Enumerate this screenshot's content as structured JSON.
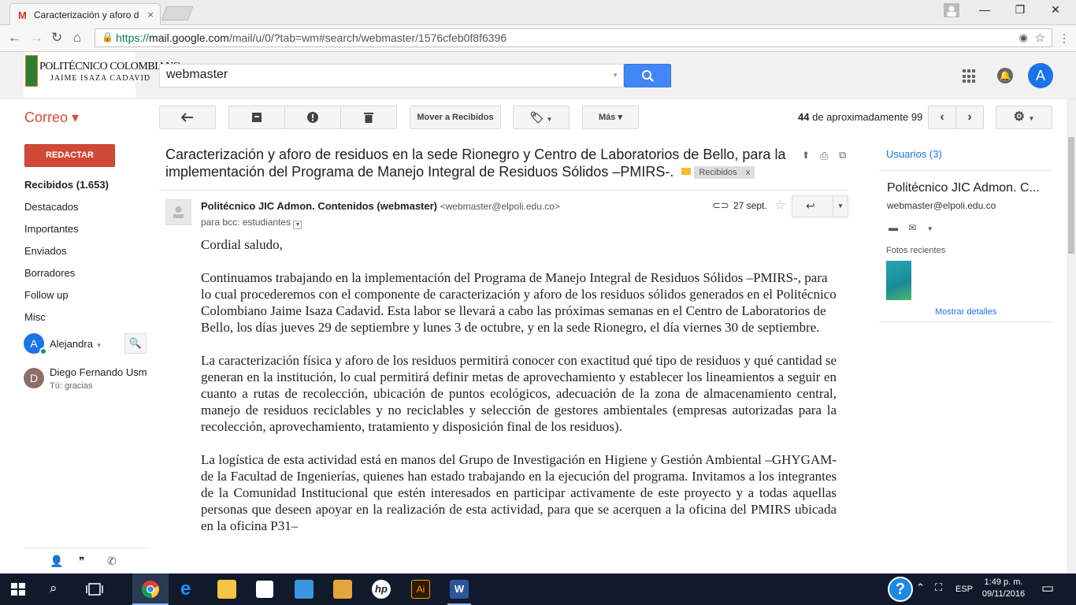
{
  "browser": {
    "tab_title": "Caracterización y aforo d",
    "url_https": "https://",
    "url_host": "mail.google.com",
    "url_path": "/mail/u/0/?tab=wm#search/webmaster/1576cfeb0f8f6396"
  },
  "header": {
    "logo_line1": "POLITÉCNICO COLOMBIANO",
    "logo_line2": "JAIME ISAZA CADAVID",
    "search_value": "webmaster",
    "account_initial": "A"
  },
  "toolbar": {
    "correo_label": "Correo ▾",
    "move_inbox_label": "Mover a Recibidos",
    "more_label": "Más ▾",
    "count_bold": "44",
    "count_text": "de aproximadamente 99"
  },
  "sidebar": {
    "compose_label": "REDACTAR",
    "items": [
      {
        "label": "Recibidos (1.653)"
      },
      {
        "label": "Destacados"
      },
      {
        "label": "Importantes"
      },
      {
        "label": "Enviados"
      },
      {
        "label": "Borradores"
      },
      {
        "label": "Follow up"
      },
      {
        "label": "Misc"
      }
    ],
    "me_initial": "A",
    "me_name": "Alejandra",
    "contact_initial": "D",
    "contact_name": "Diego Fernando Usm",
    "contact_sub": "Tú: gracias"
  },
  "message": {
    "subject": "Caracterización y aforo de residuos en la sede Rionegro y Centro de Laboratorios de Bello, para la implementación del Programa de Manejo Integral de Residuos Sólidos –PMIRS-.",
    "label_chip": "Recibidos",
    "sender_name": "Politécnico JIC Admon. Contenidos (webmaster)",
    "sender_email": "<webmaster@elpoli.edu.co>",
    "to": "para bcc: estudiantes",
    "date": "27 sept.",
    "greeting": "Cordial saludo,",
    "p1": "Continuamos trabajando en la implementación del Programa de Manejo Integral de Residuos Sólidos –PMIRS-, para lo cual procederemos con el componente de caracterización y aforo de los residuos sólidos generados en el Politécnico Colombiano Jaime Isaza Cadavid. Esta labor se llevará a cabo las próximas semanas en el Centro de Laboratorios de Bello, los días jueves 29 de septiembre y lunes 3 de octubre, y en la sede Rionegro, el día viernes 30 de septiembre.",
    "p2": "La caracterización física y aforo de los residuos permitirá conocer con exactitud qué tipo de residuos y qué cantidad se generan en la institución, lo cual permitirá definir metas de aprovechamiento y establecer los lineamientos a seguir en cuanto a rutas de recolección, ubicación de puntos ecológicos, adecuación de la zona de almacenamiento central, manejo de residuos reciclables y no reciclables y selección de gestores ambientales (empresas autorizadas para la recolección, aprovechamiento, tratamiento y disposición final de los residuos).",
    "p3": "La logística de esta actividad está en manos del Grupo de Investigación en Higiene y Gestión Ambiental –GHYGAM- de la Facultad de Ingenierías, quienes han estado trabajando en la ejecución del programa. Invitamos a los integrantes de la Comunidad Institucional que estén interesados en participar activamente de este proyecto y a todas aquellas personas que deseen apoyar en la realización de esta actividad, para que se acerquen a la oficina del PMIRS ubicada en la oficina P31–"
  },
  "right_panel": {
    "people_label": "Usuarios (3)",
    "person_name": "Politécnico JIC Admon. C...",
    "person_email": "webmaster@elpoli.edu.co",
    "recent_photos": "Fotos recientes",
    "show_details": "Mostrar detalles"
  },
  "taskbar": {
    "lang": "ESP",
    "time": "1:49 p. m.",
    "date": "09/11/2016"
  }
}
